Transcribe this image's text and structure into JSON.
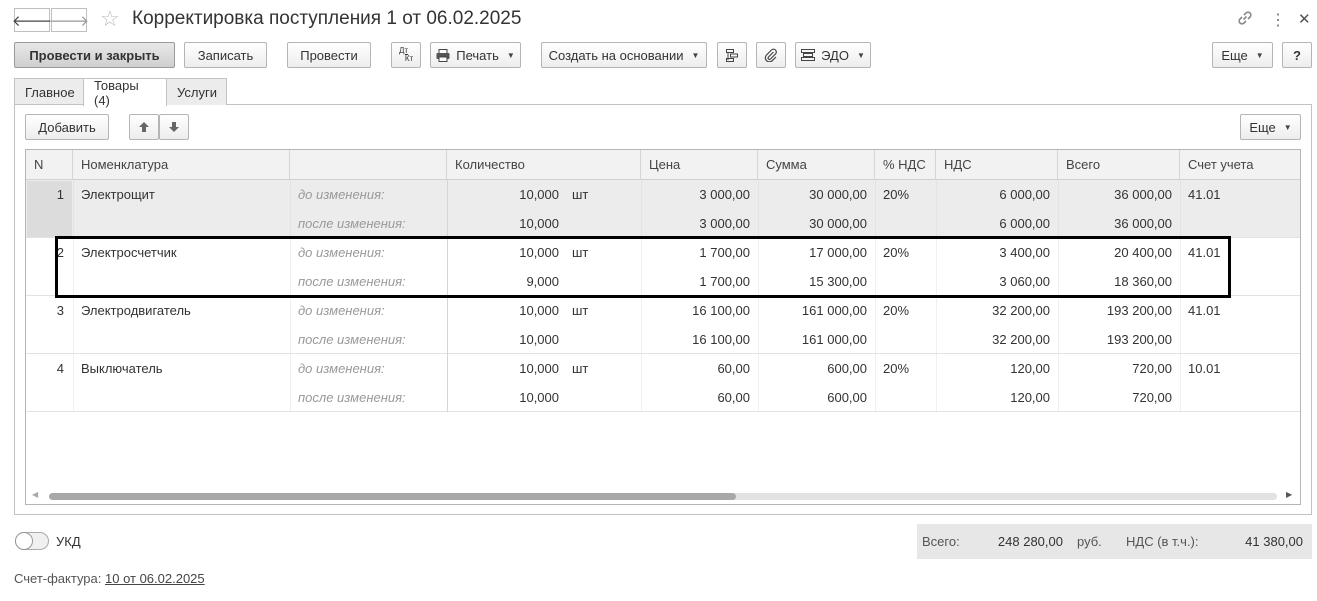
{
  "window": {
    "title": "Корректировка поступления 1 от 06.02.2025"
  },
  "icons": {
    "back": "arrow-left-icon",
    "forward": "arrow-right-icon",
    "star": "star-icon",
    "link": "link-icon",
    "more": "more-vertical-icon",
    "close": "close-icon"
  },
  "toolbar": {
    "post_close": "Провести и закрыть",
    "save": "Записать",
    "post": "Провести",
    "dtkt_top": "Дт",
    "dtkt_bottom": "Кт",
    "print": "Печать",
    "create_based": "Создать на основании",
    "edo": "ЭДО",
    "more": "Еще",
    "help": "?"
  },
  "tabs": [
    "Главное",
    "Товары (4)",
    "Услуги"
  ],
  "grid_toolbar": {
    "add": "Добавить",
    "more": "Еще"
  },
  "columns": [
    "N",
    "Номенклатура",
    "",
    "Количество",
    "Цена",
    "Сумма",
    "% НДС",
    "НДС",
    "Всего",
    "Счет учета"
  ],
  "rows": [
    {
      "n": "1",
      "name": "Электрощит",
      "unit": "шт",
      "vat_rate": "20%",
      "account": "41.01",
      "before": {
        "label": "до изменения:",
        "qty": "10,000",
        "price": "3 000,00",
        "sum": "30 000,00",
        "vat": "6 000,00",
        "total": "36 000,00"
      },
      "after": {
        "label": "после изменения:",
        "qty": "10,000",
        "price": "3 000,00",
        "sum": "30 000,00",
        "vat": "6 000,00",
        "total": "36 000,00"
      }
    },
    {
      "n": "2",
      "name": "Электросчетчик",
      "unit": "шт",
      "vat_rate": "20%",
      "account": "41.01",
      "before": {
        "label": "до изменения:",
        "qty": "10,000",
        "price": "1 700,00",
        "sum": "17 000,00",
        "vat": "3 400,00",
        "total": "20 400,00"
      },
      "after": {
        "label": "после изменения:",
        "qty": "9,000",
        "price": "1 700,00",
        "sum": "15 300,00",
        "vat": "3 060,00",
        "total": "18 360,00"
      }
    },
    {
      "n": "3",
      "name": "Электродвигатель",
      "unit": "шт",
      "vat_rate": "20%",
      "account": "41.01",
      "before": {
        "label": "до изменения:",
        "qty": "10,000",
        "price": "16 100,00",
        "sum": "161 000,00",
        "vat": "32 200,00",
        "total": "193 200,00"
      },
      "after": {
        "label": "после изменения:",
        "qty": "10,000",
        "price": "16 100,00",
        "sum": "161 000,00",
        "vat": "32 200,00",
        "total": "193 200,00"
      }
    },
    {
      "n": "4",
      "name": "Выключатель",
      "unit": "шт",
      "vat_rate": "20%",
      "account": "10.01",
      "before": {
        "label": "до изменения:",
        "qty": "10,000",
        "price": "60,00",
        "sum": "600,00",
        "vat": "120,00",
        "total": "720,00"
      },
      "after": {
        "label": "после изменения:",
        "qty": "10,000",
        "price": "60,00",
        "sum": "600,00",
        "vat": "120,00",
        "total": "720,00"
      }
    }
  ],
  "footer": {
    "ukd_label": "УКД",
    "ukd_on": false,
    "total_label": "Всего:",
    "total_value": "248 280,00",
    "currency": "руб.",
    "vat_label": "НДС (в т.ч.):",
    "vat_value": "41 380,00",
    "invoice_label": "Счет-фактура:",
    "invoice_link": "10 от 06.02.2025"
  }
}
